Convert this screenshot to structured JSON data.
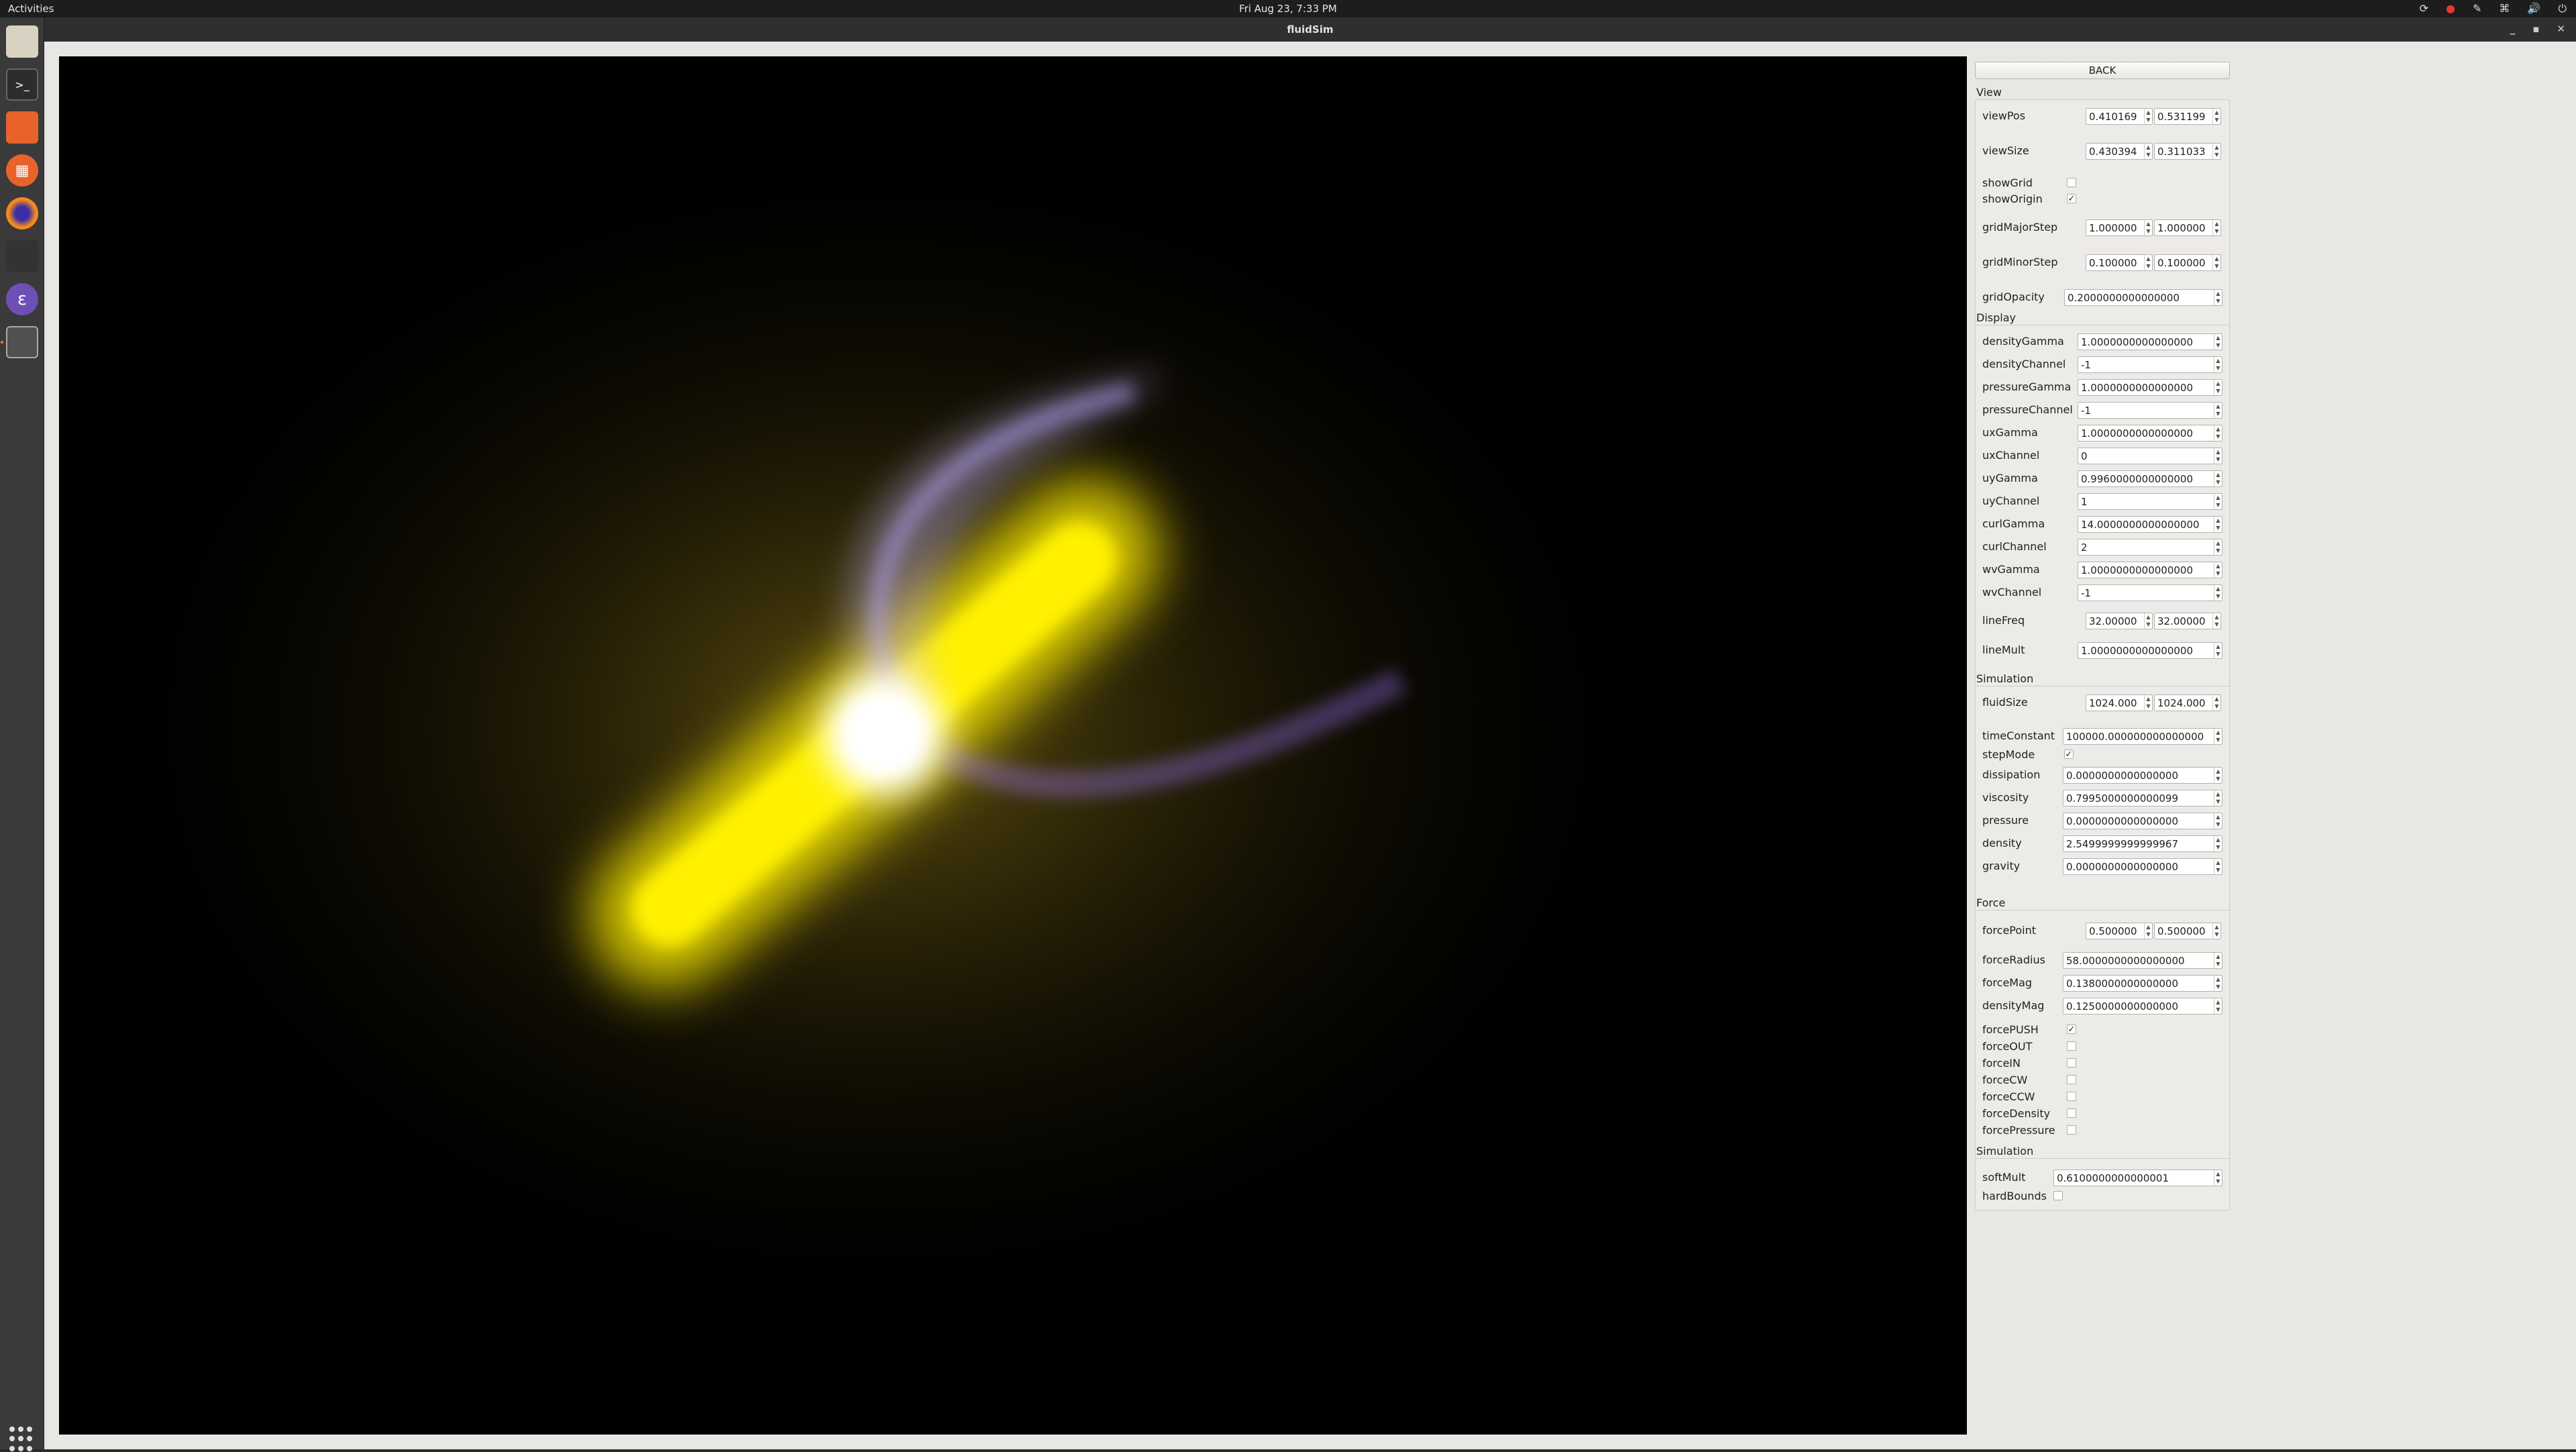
{
  "topbar": {
    "activities": "Activities",
    "clock": "Fri Aug 23,  7:33 PM"
  },
  "window": {
    "title": "fluidSim"
  },
  "panel": {
    "back": "BACK",
    "view_title": "View",
    "view": {
      "viewPos": {
        "label": "viewPos",
        "a": "0.410169",
        "b": "0.531199"
      },
      "viewSize": {
        "label": "viewSize",
        "a": "0.430394",
        "b": "0.311033"
      },
      "showGrid": {
        "label": "showGrid",
        "checked": ""
      },
      "showOrigin": {
        "label": "showOrigin",
        "checked": "✓"
      },
      "gridMajorStep": {
        "label": "gridMajorStep",
        "a": "1.000000",
        "b": "1.000000"
      },
      "gridMinorStep": {
        "label": "gridMinorStep",
        "a": "0.100000",
        "b": "0.100000"
      },
      "gridOpacity": {
        "label": "gridOpacity",
        "v": "0.2000000000000000"
      }
    },
    "display_title": "Display",
    "display": [
      {
        "label": "densityGamma",
        "v": "1.0000000000000000"
      },
      {
        "label": "densityChannel",
        "v": "-1"
      },
      {
        "label": "pressureGamma",
        "v": "1.0000000000000000"
      },
      {
        "label": "pressureChannel",
        "v": "-1"
      },
      {
        "label": "uxGamma",
        "v": "1.0000000000000000"
      },
      {
        "label": "uxChannel",
        "v": "0"
      },
      {
        "label": "uyGamma",
        "v": "0.9960000000000000"
      },
      {
        "label": "uyChannel",
        "v": "1"
      },
      {
        "label": "curlGamma",
        "v": "14.0000000000000000"
      },
      {
        "label": "curlChannel",
        "v": "2"
      },
      {
        "label": "wvGamma",
        "v": "1.0000000000000000"
      },
      {
        "label": "wvChannel",
        "v": "-1"
      }
    ],
    "lineFreq": {
      "label": "lineFreq",
      "a": "32.00000",
      "b": "32.00000"
    },
    "lineMult": {
      "label": "lineMult",
      "v": "1.0000000000000000"
    },
    "sim_title": "Simulation",
    "fluidSize": {
      "label": "fluidSize",
      "a": "1024.000",
      "b": "1024.000"
    },
    "timeConstant": {
      "label": "timeConstant",
      "v": "100000.000000000000000"
    },
    "stepMode": {
      "label": "stepMode",
      "checked": "✓"
    },
    "sim": [
      {
        "label": "dissipation",
        "v": "0.0000000000000000"
      },
      {
        "label": "viscosity",
        "v": "0.7995000000000099"
      },
      {
        "label": "pressure",
        "v": "0.0000000000000000"
      },
      {
        "label": "density",
        "v": "2.5499999999999967"
      },
      {
        "label": "gravity",
        "v": "0.0000000000000000"
      }
    ],
    "force_title": "Force",
    "forcePoint": {
      "label": "forcePoint",
      "a": "0.500000",
      "b": "0.500000"
    },
    "force": [
      {
        "label": "forceRadius",
        "v": "58.0000000000000000"
      },
      {
        "label": "forceMag",
        "v": "0.1380000000000000"
      },
      {
        "label": "densityMag",
        "v": "0.1250000000000000"
      }
    ],
    "force_checks": [
      {
        "label": "forcePUSH",
        "checked": "✓"
      },
      {
        "label": "forceOUT",
        "checked": ""
      },
      {
        "label": "forceIN",
        "checked": ""
      },
      {
        "label": "forceCW",
        "checked": ""
      },
      {
        "label": "forceCCW",
        "checked": ""
      },
      {
        "label": "forceDensity",
        "checked": ""
      },
      {
        "label": "forcePressure",
        "checked": ""
      }
    ],
    "sim2_title": "Simulation",
    "softMult": {
      "label": "softMult",
      "v": "0.6100000000000001"
    },
    "hardBounds": {
      "label": "hardBounds",
      "checked": ""
    }
  }
}
